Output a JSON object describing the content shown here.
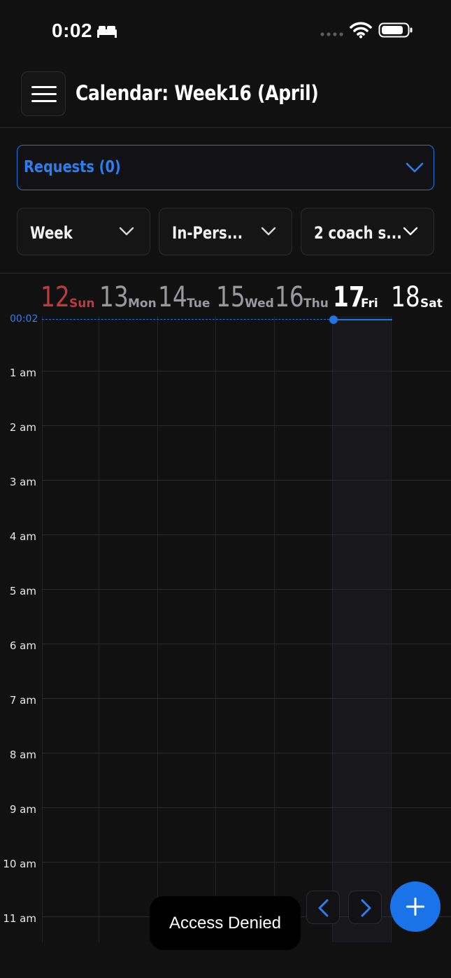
{
  "status_bar": {
    "time": "0:02",
    "icons": [
      "bed-icon",
      "signal-dots-icon",
      "wifi-icon",
      "battery-icon"
    ]
  },
  "header": {
    "title": "Calendar: Week16 (April)",
    "menu_icon": "hamburger-menu-icon"
  },
  "requests": {
    "label": "Requests (0)"
  },
  "filters": [
    {
      "label": "Week"
    },
    {
      "label": "In-Pers..."
    },
    {
      "label": "2 coach s..."
    }
  ],
  "days": [
    {
      "num": "12",
      "name": "Sun",
      "state": "weekend"
    },
    {
      "num": "13",
      "name": "Mon",
      "state": "past"
    },
    {
      "num": "14",
      "name": "Tue",
      "state": "past"
    },
    {
      "num": "15",
      "name": "Wed",
      "state": "past"
    },
    {
      "num": "16",
      "name": "Thu",
      "state": "past"
    },
    {
      "num": "17",
      "name": "Fri",
      "state": "today"
    },
    {
      "num": "18",
      "name": "Sat",
      "state": "future"
    }
  ],
  "current_time_label": "00:02",
  "hours": [
    "1 am",
    "2 am",
    "3 am",
    "4 am",
    "5 am",
    "6 am",
    "7 am",
    "8 am",
    "9 am",
    "10 am",
    "11 am"
  ],
  "toast": {
    "text": "Access Denied"
  },
  "colors": {
    "background": "#111112",
    "accent": "#1f74e0",
    "sunday": "#c0393f",
    "muted_day": "#9a9a9e",
    "today_column": "#17171c"
  }
}
